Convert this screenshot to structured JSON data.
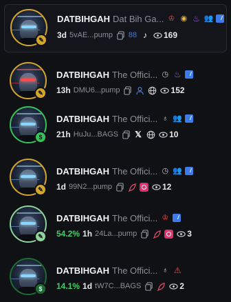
{
  "rows": [
    {
      "name": "DATBIHGAH",
      "desc": "Dat Bih Ga...",
      "age": "3d",
      "pct": "",
      "addr": "5vAE...pump",
      "views": "169",
      "tags": [
        "chef-hat-icon",
        "coin-icon",
        "flame-icon",
        "people-icon",
        "check-square-icon"
      ],
      "socials": [
        "copy-icon",
        "holders-icon",
        "tiktok-icon"
      ]
    },
    {
      "name": "DATBIHGAH",
      "desc": "The Offici...",
      "age": "13h",
      "pct": "",
      "addr": "DMU6...pump",
      "views": "152",
      "tags": [
        "clock-icon",
        "flame-icon",
        "check-square-icon"
      ],
      "socials": [
        "copy-icon",
        "user-icon",
        "globe-icon"
      ]
    },
    {
      "name": "DATBIHGAH",
      "desc": "The Offici...",
      "age": "21h",
      "pct": "",
      "addr": "HuJu...BAGS",
      "views": "10",
      "tags": [
        "moneybag-icon",
        "people-icon",
        "check-square-icon"
      ],
      "socials": [
        "copy-icon",
        "x-icon",
        "globe-icon"
      ]
    },
    {
      "name": "DATBIHGAH",
      "desc": "The Offici...",
      "age": "1d",
      "pct": "",
      "addr": "99N2...pump",
      "views": "12",
      "tags": [
        "clock-icon",
        "people-icon",
        "check-square-icon"
      ],
      "socials": [
        "copy-icon",
        "feather-icon",
        "instagram-icon"
      ]
    },
    {
      "name": "DATBIHGAH",
      "desc": "The Offici...",
      "age": "1h",
      "pct": "54.2%",
      "addr": "24La...pump",
      "views": "3",
      "tags": [
        "chef-hat-icon",
        "check-square-icon"
      ],
      "socials": [
        "copy-icon",
        "feather-icon",
        "instagram-icon"
      ]
    },
    {
      "name": "DATBIHGAH",
      "desc": "The Offici...",
      "age": "1d",
      "pct": "14.1%",
      "addr": "tW7C...BAGS",
      "views": "2",
      "tags": [
        "moneybag-icon",
        "warning-icon"
      ],
      "socials": [
        "copy-icon",
        "feather-icon"
      ]
    }
  ],
  "colors": {
    "accent_gold": "#d4a52c",
    "accent_green": "#36c25a",
    "pct_green": "#3fce6a",
    "verified_blue": "#3d7bea"
  }
}
